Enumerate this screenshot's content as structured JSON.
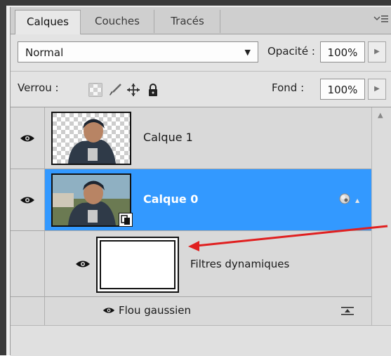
{
  "tabs": [
    {
      "label": "Calques",
      "active": true
    },
    {
      "label": "Couches",
      "active": false
    },
    {
      "label": "Tracés",
      "active": false
    }
  ],
  "panel_menu_icon": "panel-menu-icon",
  "blend": {
    "mode": "Normal",
    "opacity_label": "Opacité :",
    "opacity_value": "100%"
  },
  "lock": {
    "label": "Verrou :",
    "fill_label": "Fond :",
    "fill_value": "100%"
  },
  "layers": [
    {
      "name": "Calque 1",
      "visible": true,
      "selected": false
    },
    {
      "name": "Calque 0",
      "visible": true,
      "selected": true,
      "smart_object": true
    },
    {
      "name": "Filtres dynamiques",
      "visible": true,
      "type": "smart-filter-mask"
    },
    {
      "name": "Flou gaussien",
      "visible": true,
      "type": "filter"
    }
  ],
  "colors": {
    "selection": "#3399ff",
    "annotation_arrow": "#e02020"
  }
}
